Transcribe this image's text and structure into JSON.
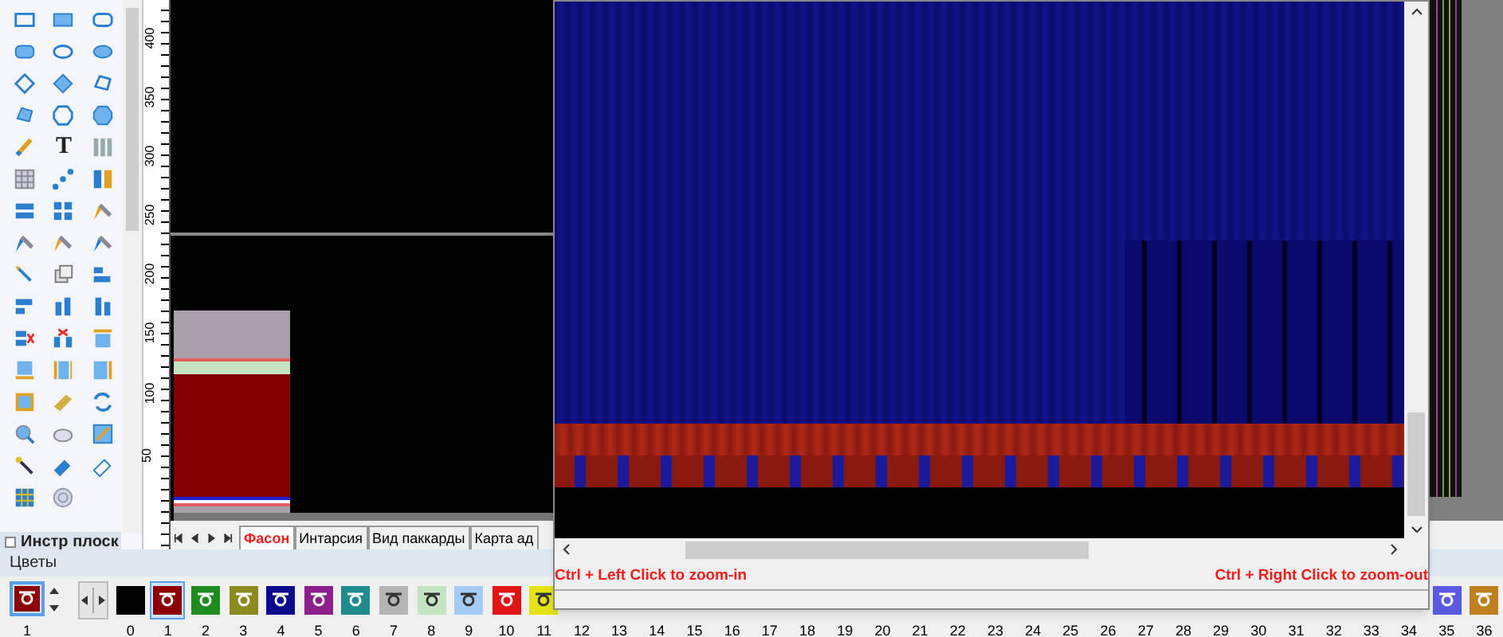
{
  "tool_panel": {
    "text_tool": "T",
    "section_title": "Инстр плоск"
  },
  "ruler": {
    "labels": [
      "400",
      "350",
      "300",
      "250",
      "200",
      "150",
      "100",
      "50"
    ]
  },
  "sheet_tabs": [
    {
      "label": "Фасон",
      "selected": true
    },
    {
      "label": "Интарсия",
      "selected": false
    },
    {
      "label": "Вид паккарды",
      "selected": false
    },
    {
      "label": "Карта ад",
      "selected": false
    }
  ],
  "zoom_window": {
    "hint_left": "Ctrl + Left Click to zoom-in",
    "hint_right": "Ctrl + Right Click to zoom-out"
  },
  "colors_panel": {
    "title": "Цветы",
    "current": {
      "label": "1",
      "color": "#8b0000"
    },
    "swatches": [
      {
        "label": "0",
        "color": "#000000",
        "selected": false
      },
      {
        "label": "1",
        "color": "#8b0000",
        "selected": true
      },
      {
        "label": "2",
        "color": "#1e8c1e",
        "selected": false
      },
      {
        "label": "3",
        "color": "#8c8c1e",
        "selected": false
      },
      {
        "label": "4",
        "color": "#0a0a8c",
        "selected": false
      },
      {
        "label": "5",
        "color": "#8c1e8c",
        "selected": false
      },
      {
        "label": "6",
        "color": "#1e8c8c",
        "selected": false
      },
      {
        "label": "7",
        "color": "#b4b4b4",
        "selected": false
      },
      {
        "label": "8",
        "color": "#c4e4c4",
        "selected": false
      },
      {
        "label": "9",
        "color": "#a4ccf4",
        "selected": false
      },
      {
        "label": "10",
        "color": "#e01414",
        "selected": false
      },
      {
        "label": "11",
        "color": "#e4e414",
        "selected": false
      },
      {
        "label": "12"
      },
      {
        "label": "13"
      },
      {
        "label": "14"
      },
      {
        "label": "15"
      },
      {
        "label": "16"
      },
      {
        "label": "17"
      },
      {
        "label": "18"
      },
      {
        "label": "19"
      },
      {
        "label": "20"
      },
      {
        "label": "21"
      },
      {
        "label": "22"
      },
      {
        "label": "23"
      },
      {
        "label": "24"
      },
      {
        "label": "25"
      },
      {
        "label": "26"
      },
      {
        "label": "27"
      },
      {
        "label": "28"
      },
      {
        "label": "29"
      },
      {
        "label": "30"
      },
      {
        "label": "31"
      },
      {
        "label": "32"
      },
      {
        "label": "33"
      },
      {
        "label": "34"
      },
      {
        "label": "35",
        "color": "#5a5ae0",
        "selected": false
      },
      {
        "label": "36",
        "color": "#c08020",
        "selected": false
      }
    ]
  }
}
